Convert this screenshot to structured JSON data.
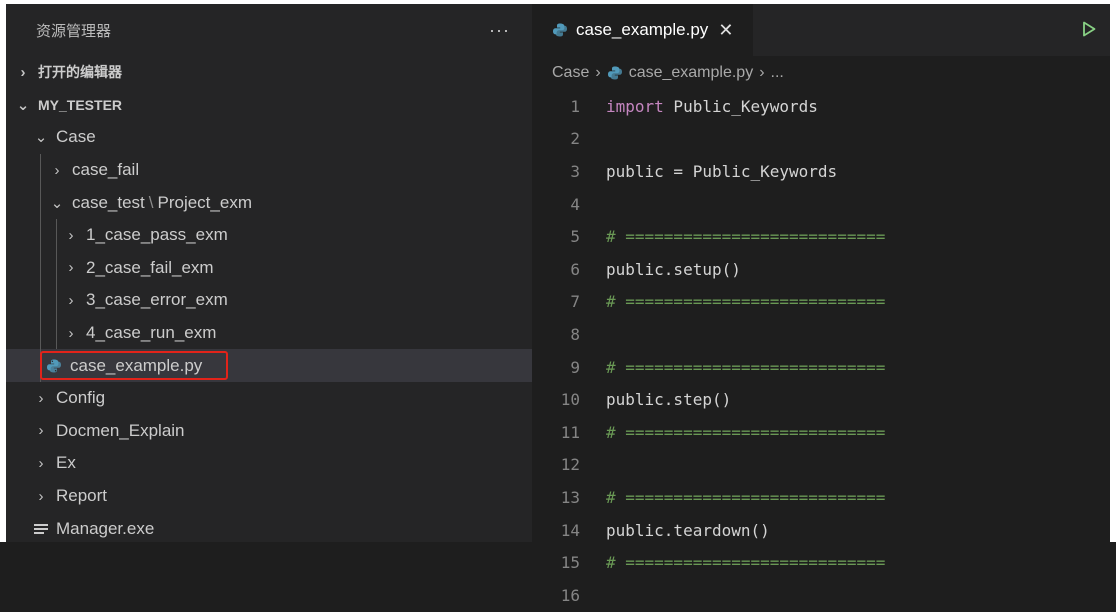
{
  "explorer": {
    "title": "资源管理器",
    "more": "···",
    "open_editors": "打开的编辑器",
    "root": "MY_TESTER",
    "items": [
      {
        "label": "Case"
      },
      {
        "label": "case_fail"
      },
      {
        "label": "case_test",
        "label2": "Project_exm",
        "sep": "\\"
      },
      {
        "label": "1_case_pass_exm"
      },
      {
        "label": "2_case_fail_exm"
      },
      {
        "label": "3_case_error_exm"
      },
      {
        "label": "4_case_run_exm"
      },
      {
        "label": "case_example.py"
      },
      {
        "label": "Config"
      },
      {
        "label": "Docmen_Explain"
      },
      {
        "label": "Ex"
      },
      {
        "label": "Report"
      },
      {
        "label": "Manager.exe"
      }
    ]
  },
  "editor": {
    "tab_label": "case_example.py",
    "close_glyph": "✕",
    "breadcrumb": {
      "folder": "Case",
      "file": "case_example.py",
      "more": "..."
    },
    "lines": [
      {
        "n": "1",
        "kw": "import",
        "text": " Public_Keywords"
      },
      {
        "n": "2",
        "text": ""
      },
      {
        "n": "3",
        "text": "public = Public_Keywords"
      },
      {
        "n": "4",
        "text": ""
      },
      {
        "n": "5",
        "comment": "# ==========================="
      },
      {
        "n": "6",
        "text": "public.setup()"
      },
      {
        "n": "7",
        "comment": "# ==========================="
      },
      {
        "n": "8",
        "text": ""
      },
      {
        "n": "9",
        "comment": "# ==========================="
      },
      {
        "n": "10",
        "text": "public.step()"
      },
      {
        "n": "11",
        "comment": "# ==========================="
      },
      {
        "n": "12",
        "text": ""
      },
      {
        "n": "13",
        "comment": "# ==========================="
      },
      {
        "n": "14",
        "text": "public.teardown()"
      },
      {
        "n": "15",
        "comment": "# ==========================="
      },
      {
        "n": "16",
        "text": ""
      }
    ]
  },
  "colors": {
    "python_icon": "#519aba",
    "highlight_box": "#e2231a",
    "run_button": "#89d185"
  },
  "icons": [
    "chevron-right-icon",
    "chevron-down-icon",
    "python-file-icon",
    "menu-file-icon",
    "close-icon",
    "run-icon"
  ]
}
